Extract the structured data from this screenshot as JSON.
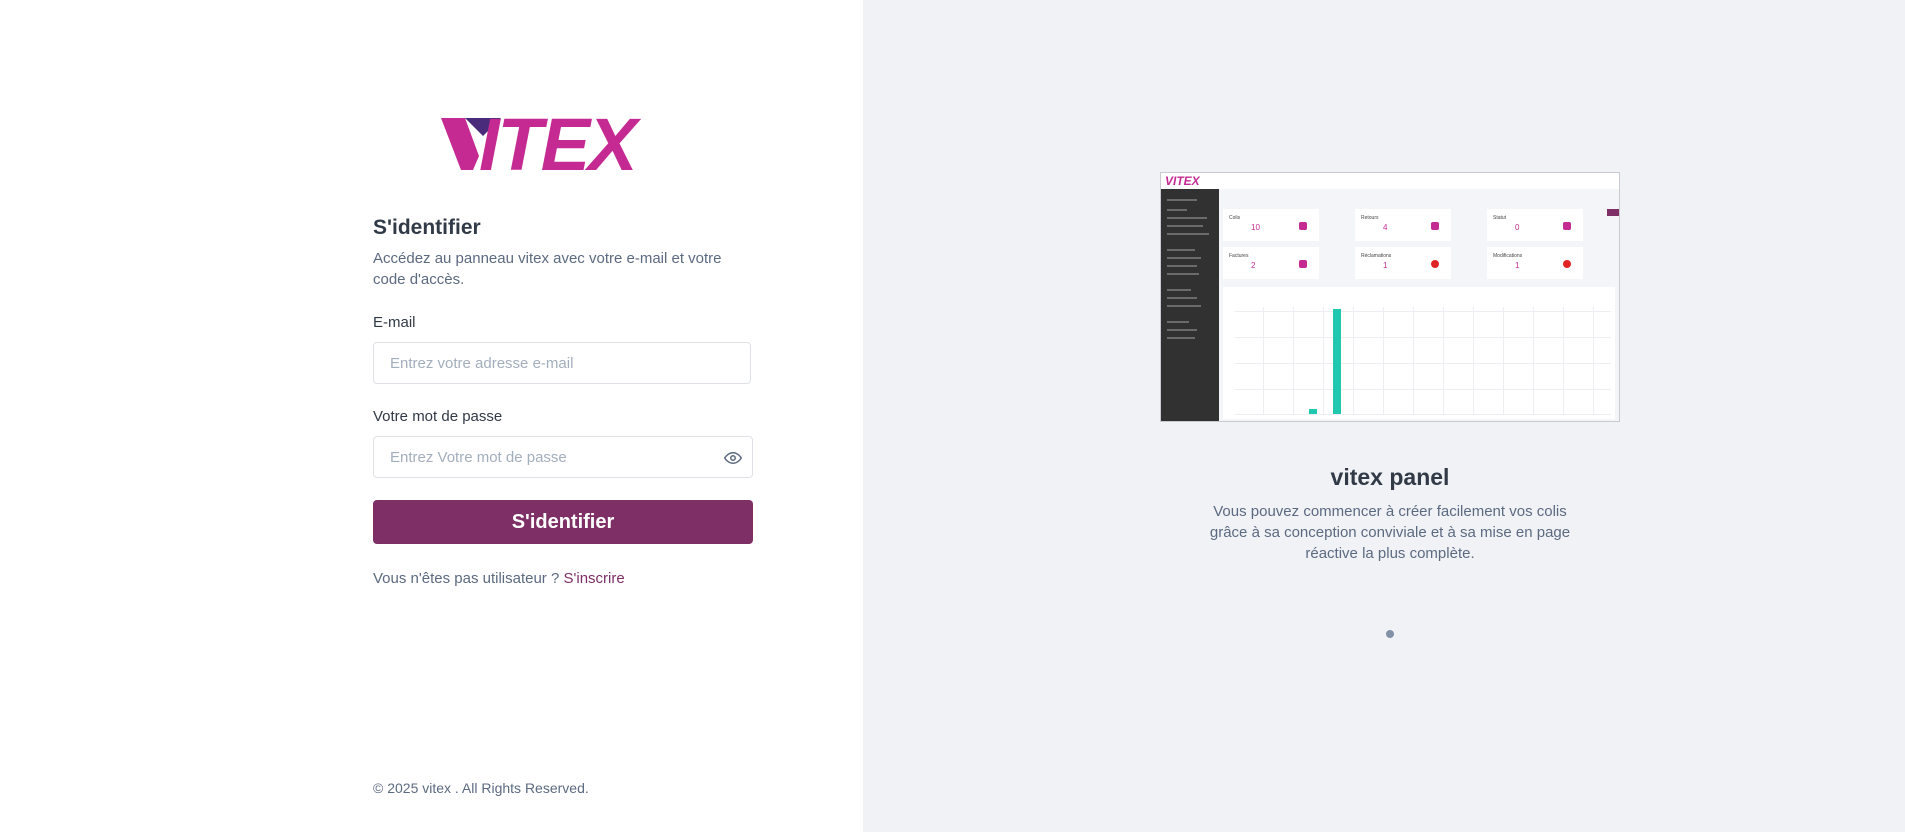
{
  "brand": {
    "logo_text": "VITEX",
    "color": "#c52a93",
    "accent": "#7e2f66"
  },
  "login": {
    "title": "S'identifier",
    "subtitle": "Accédez au panneau vitex avec votre e-mail et votre code d'accès.",
    "email_label": "E-mail",
    "email_placeholder": "Entrez votre adresse e-mail",
    "password_label": "Votre mot de passe",
    "password_placeholder": "Entrez Votre mot de passe",
    "password_toggle_icon": "eye-icon",
    "submit_label": "S'identifier",
    "signup_prompt": "Vous n'êtes pas utilisateur ?",
    "signup_link": "S'inscrire"
  },
  "footer": {
    "copyright": "© 2025 vitex . All Rights Reserved."
  },
  "carousel": {
    "title": "vitex panel",
    "text": "Vous pouvez commencer à créer facilement vos colis grâce à sa conception conviviale et à sa mise en page réactive la plus complète.",
    "active_slide": 1,
    "slide_count": 1
  },
  "preview": {
    "cards": [
      "10",
      "4",
      "0",
      "2",
      "1",
      "1"
    ]
  }
}
